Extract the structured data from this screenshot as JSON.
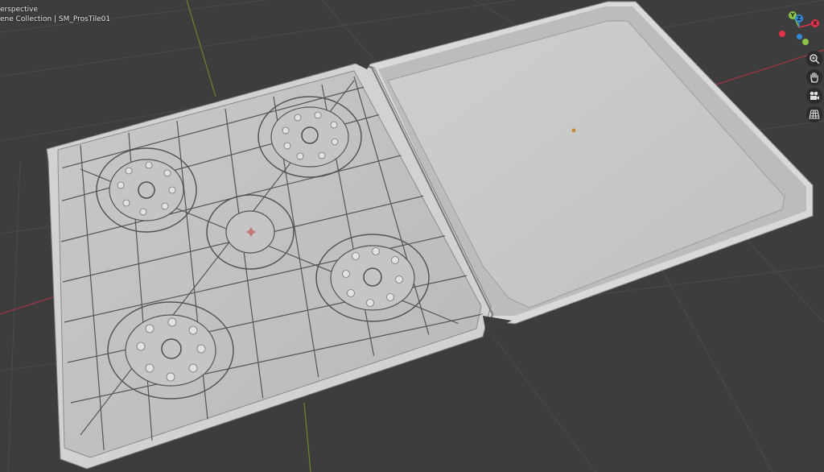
{
  "viewport": {
    "view_mode": "erspective",
    "collection_info": "ene Collection | SM_ProsTile01"
  },
  "gizmo": {
    "axes": [
      {
        "name": "y-axis",
        "label": "Y",
        "color": "#8bc34a"
      },
      {
        "name": "z-axis",
        "label": "Z",
        "color": "#2f8ad8"
      },
      {
        "name": "x-axis",
        "label": "X",
        "color": "#e0334a"
      },
      {
        "name": "neg-x-axis",
        "label": "",
        "color": "#e0334a"
      },
      {
        "name": "neg-y-axis",
        "label": "",
        "color": "#8bc34a"
      },
      {
        "name": "neg-z-axis",
        "label": "",
        "color": "#2f8ad8"
      }
    ]
  },
  "nav_tools": [
    {
      "name": "zoom-icon"
    },
    {
      "name": "pan-hand-icon"
    },
    {
      "name": "camera-view-icon"
    },
    {
      "name": "ortho-grid-icon"
    }
  ],
  "colors": {
    "background": "#3d3d3d",
    "grid": "#4a4a4a",
    "x_axis_line": "#a33545",
    "y_axis_line": "#6b8a2b",
    "tile_face": "#c4c4c4",
    "origin": "#c98a3b"
  }
}
